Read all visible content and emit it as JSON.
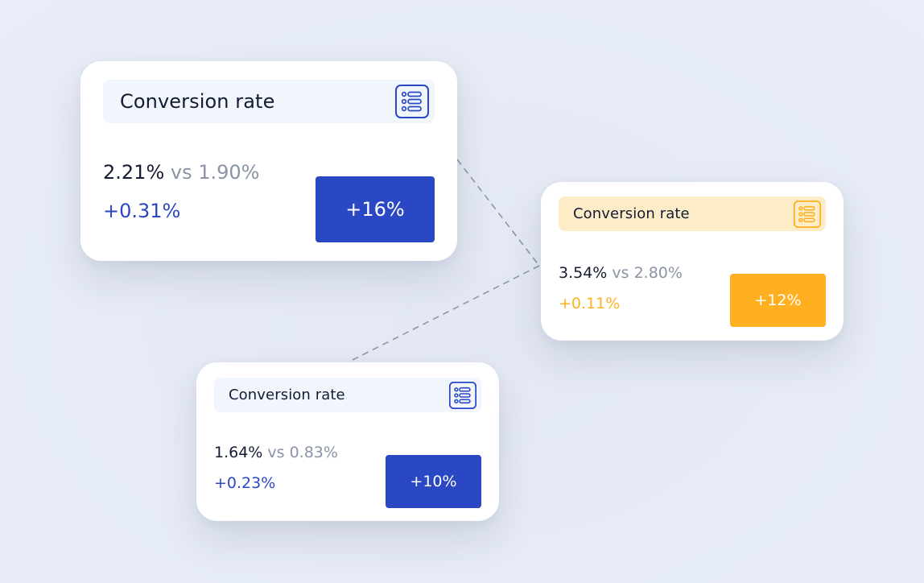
{
  "colors": {
    "blue_accent": "#2a47c4",
    "amber_accent": "#ffb020",
    "blue_header_bg": "#f1f6fd",
    "amber_header_bg": "#fdecc8",
    "primary_text": "#141b33",
    "muted_text": "#8a94a6"
  },
  "cards": [
    {
      "title": "Conversion rate",
      "icon": "list-icon",
      "current": "2.21%",
      "comparison": "vs 1.90%",
      "delta": "+0.31%",
      "badge": "+16%",
      "theme": "blue"
    },
    {
      "title": "Conversion rate",
      "icon": "list-icon",
      "current": "3.54%",
      "comparison": "vs 2.80%",
      "delta": "+0.11%",
      "badge": "+12%",
      "theme": "amber"
    },
    {
      "title": "Conversion rate",
      "icon": "list-icon",
      "current": "1.64%",
      "comparison": "vs 0.83%",
      "delta": "+0.23%",
      "badge": "+10%",
      "theme": "blue"
    }
  ]
}
